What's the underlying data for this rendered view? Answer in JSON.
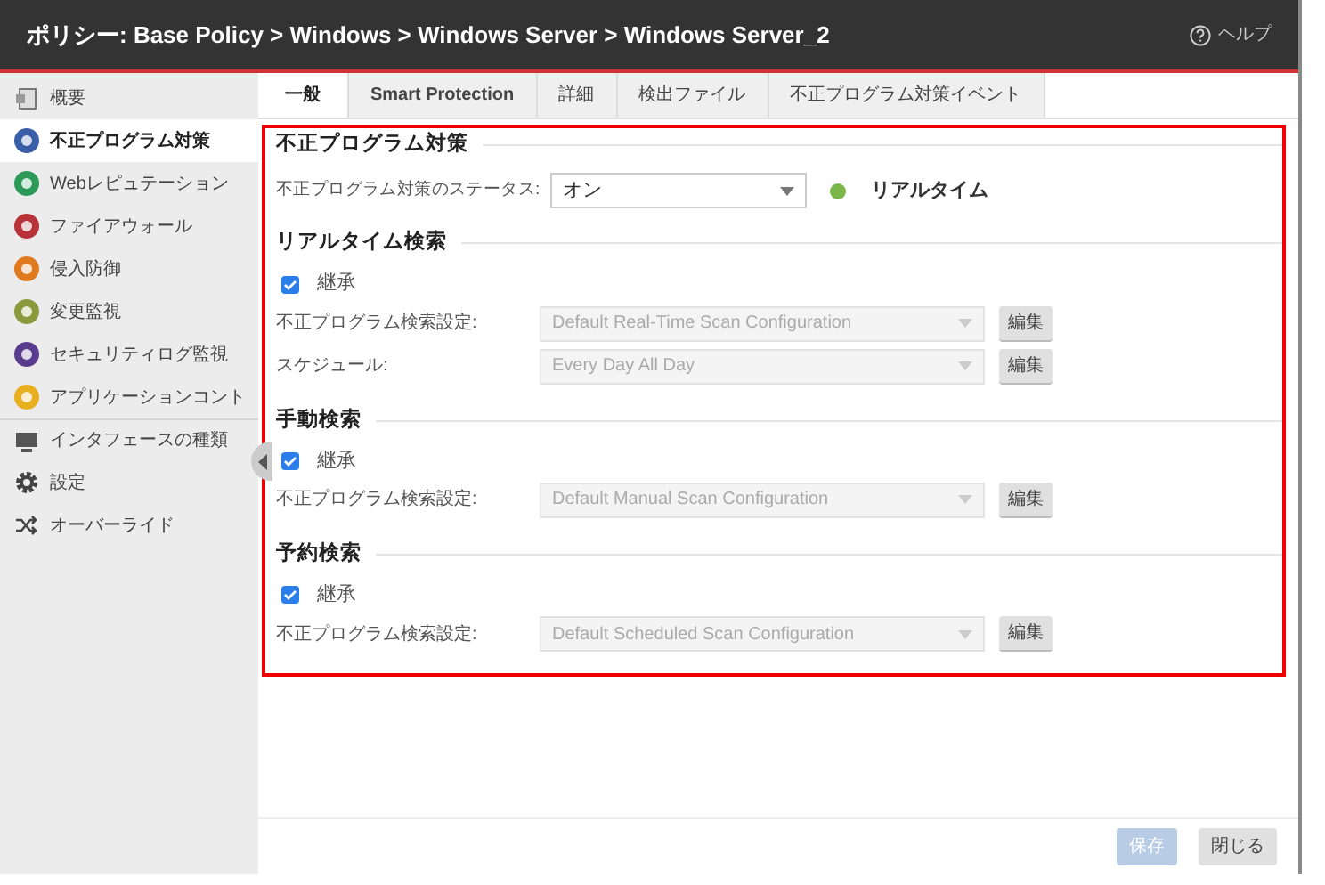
{
  "window": {
    "title": "ポリシー: Base Policy > Windows > Windows Server > Windows Server_2",
    "help": "ヘルプ"
  },
  "sidebar": {
    "items": [
      {
        "label": "概要",
        "kind": "document",
        "selected": false,
        "separated": false
      },
      {
        "label": "不正プログラム対策",
        "kind": "circle",
        "color": "#3b5ea8",
        "selected": true,
        "separated": false
      },
      {
        "label": "Webレピュテーション",
        "kind": "circle",
        "color": "#2e9a5a",
        "selected": false,
        "separated": false
      },
      {
        "label": "ファイアウォール",
        "kind": "circle",
        "color": "#b8323a",
        "selected": false,
        "separated": false
      },
      {
        "label": "侵入防御",
        "kind": "circle",
        "color": "#e07a1f",
        "selected": false,
        "separated": false
      },
      {
        "label": "変更監視",
        "kind": "circle",
        "color": "#8a9a3c",
        "selected": false,
        "separated": false
      },
      {
        "label": "セキュリティログ監視",
        "kind": "circle",
        "color": "#5a3c8e",
        "selected": false,
        "separated": false
      },
      {
        "label": "アプリケーションコント",
        "kind": "circle",
        "color": "#e8b020",
        "selected": false,
        "separated": false
      },
      {
        "label": "インタフェースの種類",
        "kind": "monitor",
        "selected": false,
        "separated": true
      },
      {
        "label": "設定",
        "kind": "gear",
        "selected": false,
        "separated": false
      },
      {
        "label": "オーバーライド",
        "kind": "shuffle",
        "selected": false,
        "separated": false
      }
    ]
  },
  "tabs": [
    {
      "label": "一般",
      "selected": true
    },
    {
      "label": "Smart Protection",
      "selected": false
    },
    {
      "label": "詳細",
      "selected": false
    },
    {
      "label": "検出ファイル",
      "selected": false
    },
    {
      "label": "不正プログラム対策イベント",
      "selected": false
    }
  ],
  "sections": [
    {
      "title": "不正プログラム対策",
      "rows": [
        {
          "kind": "status",
          "label": "不正プログラム対策のステータス:",
          "value": "オン",
          "indicator": "リアルタイム",
          "color": "#7ab648"
        }
      ]
    },
    {
      "title": "リアルタイム検索",
      "rows": [
        {
          "kind": "checkbox",
          "label": "継承",
          "checked": true
        },
        {
          "kind": "setting",
          "label": "不正プログラム検索設定:",
          "value": "Default Real-Time Scan Configuration",
          "disabled": true,
          "button": "編集"
        },
        {
          "kind": "setting",
          "label": "スケジュール:",
          "value": "Every Day All Day",
          "disabled": true,
          "button": "編集"
        }
      ]
    },
    {
      "title": "手動検索",
      "rows": [
        {
          "kind": "checkbox",
          "label": "継承",
          "checked": true
        },
        {
          "kind": "setting",
          "label": "不正プログラム検索設定:",
          "value": "Default Manual Scan Configuration",
          "disabled": true,
          "button": "編集"
        }
      ]
    },
    {
      "title": "予約検索",
      "rows": [
        {
          "kind": "checkbox",
          "label": "継承",
          "checked": true
        },
        {
          "kind": "setting",
          "label": "不正プログラム検索設定:",
          "value": "Default Scheduled Scan Configuration",
          "disabled": true,
          "button": "編集"
        }
      ]
    }
  ],
  "footer": {
    "buttons": [
      {
        "label": "保存",
        "disabled": true
      },
      {
        "label": "閉じる",
        "disabled": false
      }
    ]
  }
}
